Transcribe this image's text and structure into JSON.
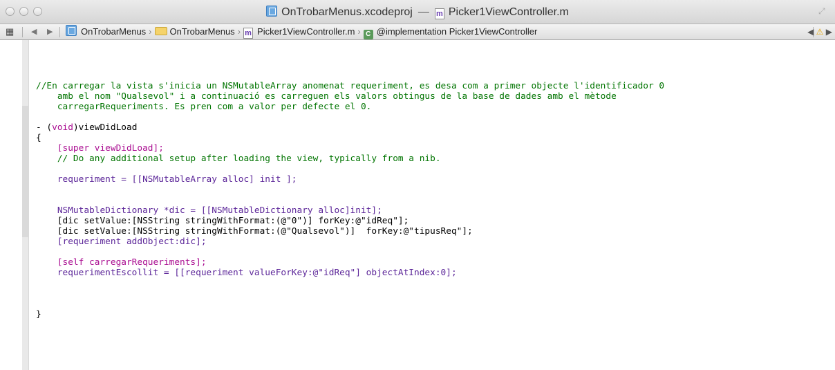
{
  "window": {
    "project_name": "OnTrobarMenus.xcodeproj",
    "separator": "—",
    "file_name": "Picker1ViewController.m",
    "file_icon_letter": "m"
  },
  "jumpbar": {
    "grid_glyph": "▦",
    "back_glyph": "◀",
    "forward_glyph": "▶",
    "chevron": "›",
    "crumbs": [
      "OnTrobarMenus",
      "OnTrobarMenus",
      "Picker1ViewController.m",
      "@implementation Picker1ViewController"
    ],
    "class_icon_letter": "C",
    "right_glyph": "◀",
    "warning_glyph": "⚠",
    "right_fwd_glyph": "▶"
  },
  "code": {
    "comment_1": "//En carregar la vista s'inicia un NSMutableArray anomenat requeriment, es desa com a primer objecte l'identificador 0",
    "comment_2": "    amb el nom \"Qualsevol\" i a continuació es carreguen els valors obtingus de la base de dades amb el mètode",
    "comment_3": "    carregarRequeriments. Es pren com a valor per defecte el 0.",
    "sig_prefix": "- (",
    "sig_void": "void",
    "sig_rest": ")viewDidLoad",
    "open_brace": "{",
    "super_call": "    [super viewDidLoad];",
    "setup_comment": "    // Do any additional setup after loading the view, typically from a nib.",
    "alloc_line": "    requeriment = [[NSMutableArray alloc] init ];",
    "dict_line": "    NSMutableDictionary *dic = [[NSMutableDictionary alloc]init];",
    "set_value_1": "    [dic setValue:[NSString stringWithFormat:(@\"0\")] forKey:@\"idReq\"];",
    "set_value_2": "    [dic setValue:[NSString stringWithFormat:(@\"Qualsevol\")]  forKey:@\"tipusReq\"];",
    "add_object": "    [requeriment addObject:dic];",
    "self_call": "    [self carregarRequeriments];",
    "escollit_line": "    requerimentEscollit = [[requeriment valueForKey:@\"idReq\"] objectAtIndex:0];",
    "close_brace": "}"
  }
}
